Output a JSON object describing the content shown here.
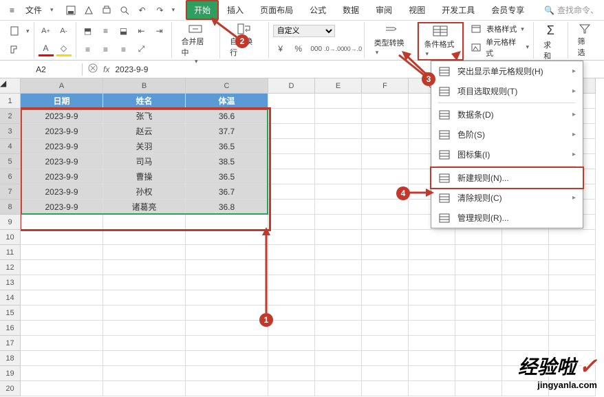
{
  "topbar": {
    "file": "文件",
    "tabs": [
      "开始",
      "插入",
      "页面布局",
      "公式",
      "数据",
      "审阅",
      "视图",
      "开发工具",
      "会员专享"
    ],
    "active_tab": 0,
    "search_placeholder": "查找命令、"
  },
  "ribbon": {
    "merge": "合并居中",
    "wrap": "自动换行",
    "num_format": "自定义",
    "type_convert": "类型转换",
    "cond_format": "条件格式",
    "table_style": "表格样式",
    "cell_style": "单元格样式",
    "sum": "求和",
    "filter": "筛选"
  },
  "namebox": {
    "ref": "A2",
    "formula": "2023-9-9"
  },
  "sheet": {
    "col_widths": {
      "A": 120,
      "B": 120,
      "C": 120,
      "D": 68,
      "E": 68,
      "F": 68,
      "G": 68,
      "H": 68,
      "I": 68,
      "J": 68
    },
    "cols": [
      "A",
      "B",
      "C",
      "D",
      "E",
      "F",
      "G",
      "H",
      "I",
      "J"
    ],
    "rows_count": 20,
    "headers": [
      "日期",
      "姓名",
      "体温"
    ],
    "data": [
      [
        "2023-9-9",
        "张飞",
        "36.6"
      ],
      [
        "2023-9-9",
        "赵云",
        "37.7"
      ],
      [
        "2023-9-9",
        "关羽",
        "36.5"
      ],
      [
        "2023-9-9",
        "司马",
        "38.5"
      ],
      [
        "2023-9-9",
        "曹操",
        "36.5"
      ],
      [
        "2023-9-9",
        "孙权",
        "36.7"
      ],
      [
        "2023-9-9",
        "诸葛亮",
        "36.8"
      ]
    ]
  },
  "dropdown": [
    {
      "icon": "highlight",
      "label": "突出显示单元格规则(H)",
      "sub": true
    },
    {
      "icon": "topn",
      "label": "项目选取规则(T)",
      "sub": true
    },
    {
      "sep": true
    },
    {
      "icon": "databar",
      "label": "数据条(D)",
      "sub": true
    },
    {
      "icon": "colorscale",
      "label": "色阶(S)",
      "sub": true
    },
    {
      "icon": "iconset",
      "label": "图标集(I)",
      "sub": true
    },
    {
      "sep": true
    },
    {
      "icon": "new",
      "label": "新建规则(N)...",
      "highlight": true
    },
    {
      "icon": "clear",
      "label": "清除规则(C)",
      "sub": true
    },
    {
      "icon": "manage",
      "label": "管理规则(R)..."
    }
  ],
  "steps": {
    "1": "1",
    "2": "2",
    "3": "3",
    "4": "4"
  },
  "watermark": {
    "title": "经验啦",
    "url": "jingyanla.com"
  }
}
